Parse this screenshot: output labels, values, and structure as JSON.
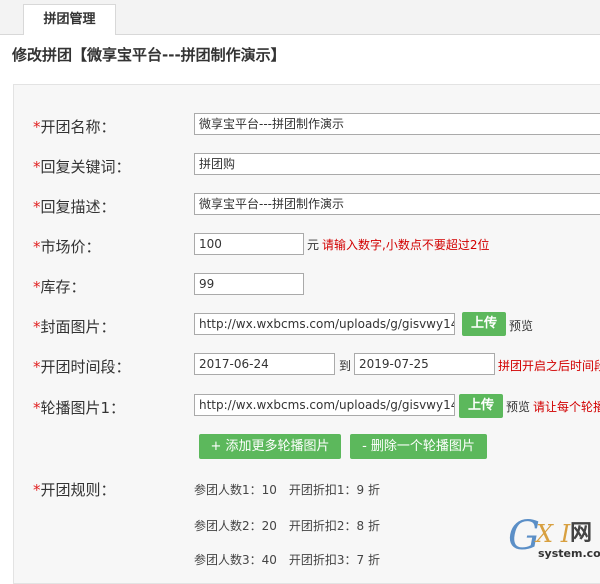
{
  "tab": {
    "label": "拼团管理"
  },
  "page_title": "修改拼团【微享宝平台---拼团制作演示】",
  "form": {
    "name": {
      "required": "*",
      "label": "开团名称：",
      "value": "微享宝平台---拼团制作演示"
    },
    "keyword": {
      "required": "*",
      "label": "回复关键词：",
      "value": "拼团购"
    },
    "description": {
      "required": "*",
      "label": "回复描述：",
      "value": "微享宝平台---拼团制作演示"
    },
    "price": {
      "required": "*",
      "label": "市场价：",
      "value": "100",
      "unit": "元",
      "hint": "请输入数字,小数点不要超过2位"
    },
    "stock": {
      "required": "*",
      "label": "库存：",
      "value": "99"
    },
    "cover": {
      "required": "*",
      "label": "封面图片：",
      "value": "http://wx.wxbcms.com/uploads/g/gisvwy14",
      "upload_label": "上传",
      "preview_label": "预览"
    },
    "period": {
      "required": "*",
      "label": "开团时间段：",
      "start": "2017-06-24",
      "to_label": "到",
      "end": "2019-07-25",
      "hint": "拼团开启之后时间段"
    },
    "carousel": {
      "required": "*",
      "label": "轮播图片1：",
      "value": "http://wx.wxbcms.com/uploads/g/gisvwy14",
      "upload_label": "上传",
      "preview_label": "预览",
      "hint": "请让每个轮播"
    },
    "add_carousel_label": "+ 添加更多轮播图片",
    "remove_carousel_label": "- 删除一个轮播图片",
    "rules": {
      "required": "*",
      "label": "开团规则：",
      "items": [
        "参团人数1：10　开团折扣1：9 折",
        "参团人数2：20　开团折扣2：8 折",
        "参团人数3：40　开团折扣3：7 折"
      ]
    }
  },
  "watermark": {
    "g": "G",
    "xi": "X I",
    "wang": "网",
    "domain": "system.com"
  },
  "colors": {
    "accent_green": "#5cb85c",
    "required_red": "#e02020",
    "hint_red": "#d20000"
  }
}
